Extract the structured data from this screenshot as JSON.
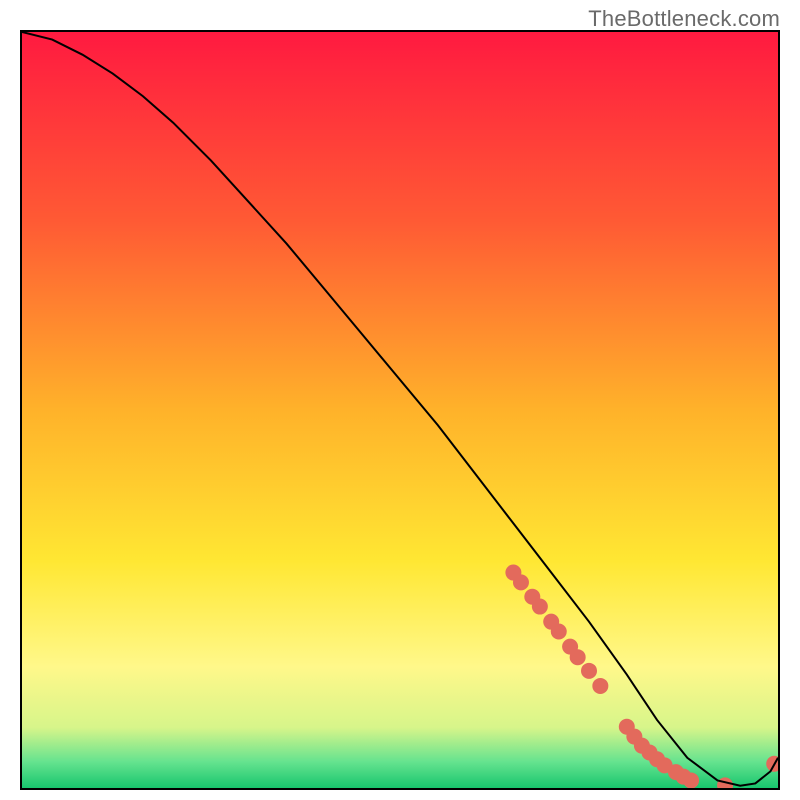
{
  "watermark": "TheBottleneck.com",
  "chart_data": {
    "type": "line",
    "title": "",
    "xlabel": "",
    "ylabel": "",
    "xlim": [
      0,
      100
    ],
    "ylim": [
      0,
      100
    ],
    "grid": false,
    "legend": false,
    "gradient_stops": [
      {
        "offset": 0.0,
        "color": "#ff1a40"
      },
      {
        "offset": 0.25,
        "color": "#ff5a34"
      },
      {
        "offset": 0.5,
        "color": "#ffb22a"
      },
      {
        "offset": 0.7,
        "color": "#ffe733"
      },
      {
        "offset": 0.84,
        "color": "#fff88a"
      },
      {
        "offset": 0.92,
        "color": "#d7f58a"
      },
      {
        "offset": 0.965,
        "color": "#66e38f"
      },
      {
        "offset": 1.0,
        "color": "#18c66e"
      }
    ],
    "series": [
      {
        "name": "bottleneck-curve",
        "color": "#000000",
        "x": [
          0,
          4,
          8,
          12,
          16,
          20,
          25,
          30,
          35,
          40,
          45,
          50,
          55,
          60,
          65,
          70,
          75,
          80,
          84,
          88,
          92,
          95,
          97,
          99,
          100
        ],
        "y": [
          100,
          99,
          97,
          94.5,
          91.5,
          88,
          83,
          77.5,
          72,
          66,
          60,
          54,
          48,
          41.5,
          35,
          28.5,
          22,
          15,
          9,
          4,
          1,
          0.3,
          0.6,
          2.2,
          4
        ]
      }
    ],
    "markers": {
      "name": "highlight-dots",
      "color": "#e36a5c",
      "radius_px": 8,
      "x": [
        65,
        66,
        67.5,
        68.5,
        70,
        71,
        72.5,
        73.5,
        75,
        76.5,
        80,
        81,
        82,
        83,
        84,
        85,
        86.5,
        87.5,
        88.5,
        93,
        99.5
      ],
      "y": [
        28.5,
        27.2,
        25.3,
        24,
        22,
        20.7,
        18.7,
        17.3,
        15.5,
        13.5,
        8.1,
        6.8,
        5.6,
        4.7,
        3.8,
        3,
        2.1,
        1.5,
        1,
        0.35,
        3.2
      ]
    }
  }
}
